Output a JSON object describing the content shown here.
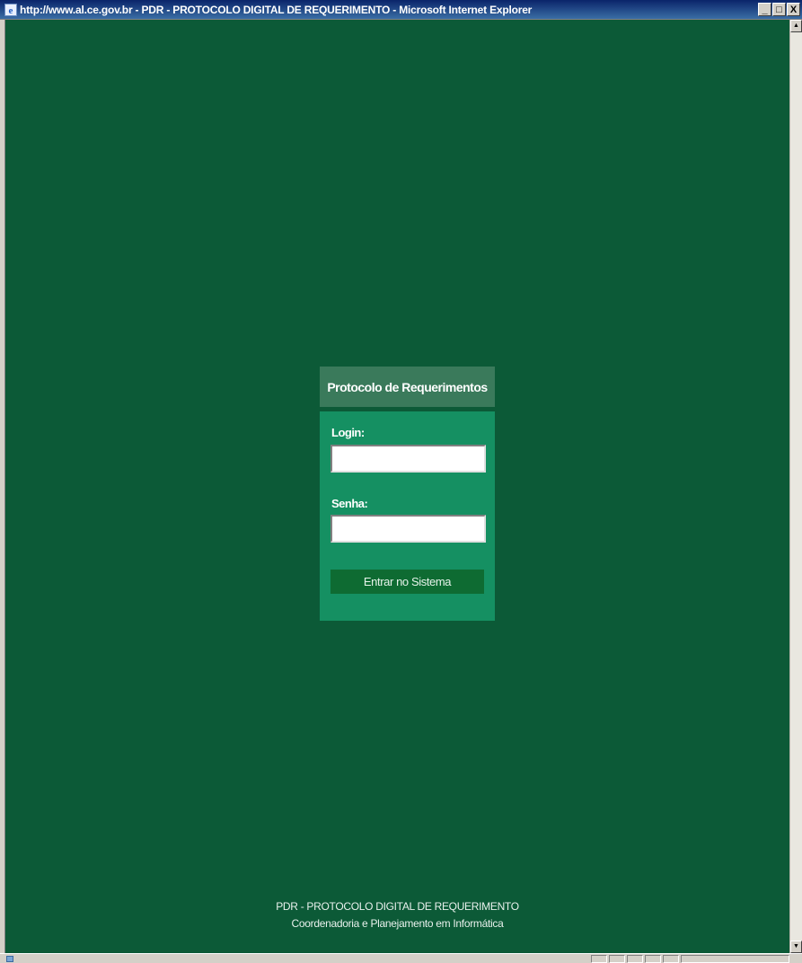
{
  "window": {
    "title": "http://www.al.ce.gov.br - PDR - PROTOCOLO DIGITAL DE REQUERIMENTO - Microsoft Internet Explorer",
    "controls": {
      "minimize": "_",
      "maximize": "□",
      "close": "X"
    },
    "icon": "ie-icon"
  },
  "colors": {
    "page_background": "#0c5a37",
    "header_background": "#3a7a5b",
    "panel_background": "#159062",
    "button_background": "#0e6b32"
  },
  "login": {
    "header": "Protocolo de Requerimentos",
    "login_label": "Login:",
    "login_value": "",
    "password_label": "Senha:",
    "password_value": "",
    "submit_label": "Entrar no Sistema"
  },
  "footer": {
    "line1": "PDR - PROTOCOLO DIGITAL DE REQUERIMENTO",
    "line2": "Coordenadoria e Planejamento em Informática"
  }
}
